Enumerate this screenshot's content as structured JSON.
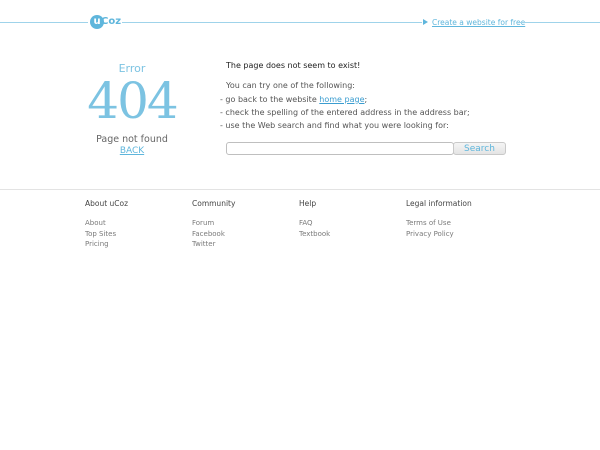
{
  "header": {
    "logo_mark": "u",
    "logo_text": "Coz",
    "create_link": "Create a website for free"
  },
  "error": {
    "word": "Error",
    "code": "404",
    "not_found": "Page not found",
    "back": "BACK"
  },
  "message": {
    "title": "The page does not seem to exist!",
    "try": "You can try one of the following:",
    "opt1_prefix": "- go back to the website ",
    "opt1_link": "home page",
    "opt1_suffix": ";",
    "opt2": "- check the spelling of the entered address in the address bar;",
    "opt3": "- use the Web search and find what you were looking for:",
    "search_value": "",
    "search_button": "Search"
  },
  "footer": {
    "about": {
      "heading": "About uCoz",
      "items": [
        "About",
        "Top Sites",
        "Pricing"
      ]
    },
    "community": {
      "heading": "Community",
      "items": [
        "Forum",
        "Facebook",
        "Twitter"
      ]
    },
    "help": {
      "heading": "Help",
      "items": [
        "FAQ",
        "Textbook"
      ]
    },
    "legal": {
      "heading": "Legal information",
      "items": [
        "Terms of Use",
        "Privacy Policy"
      ]
    }
  }
}
